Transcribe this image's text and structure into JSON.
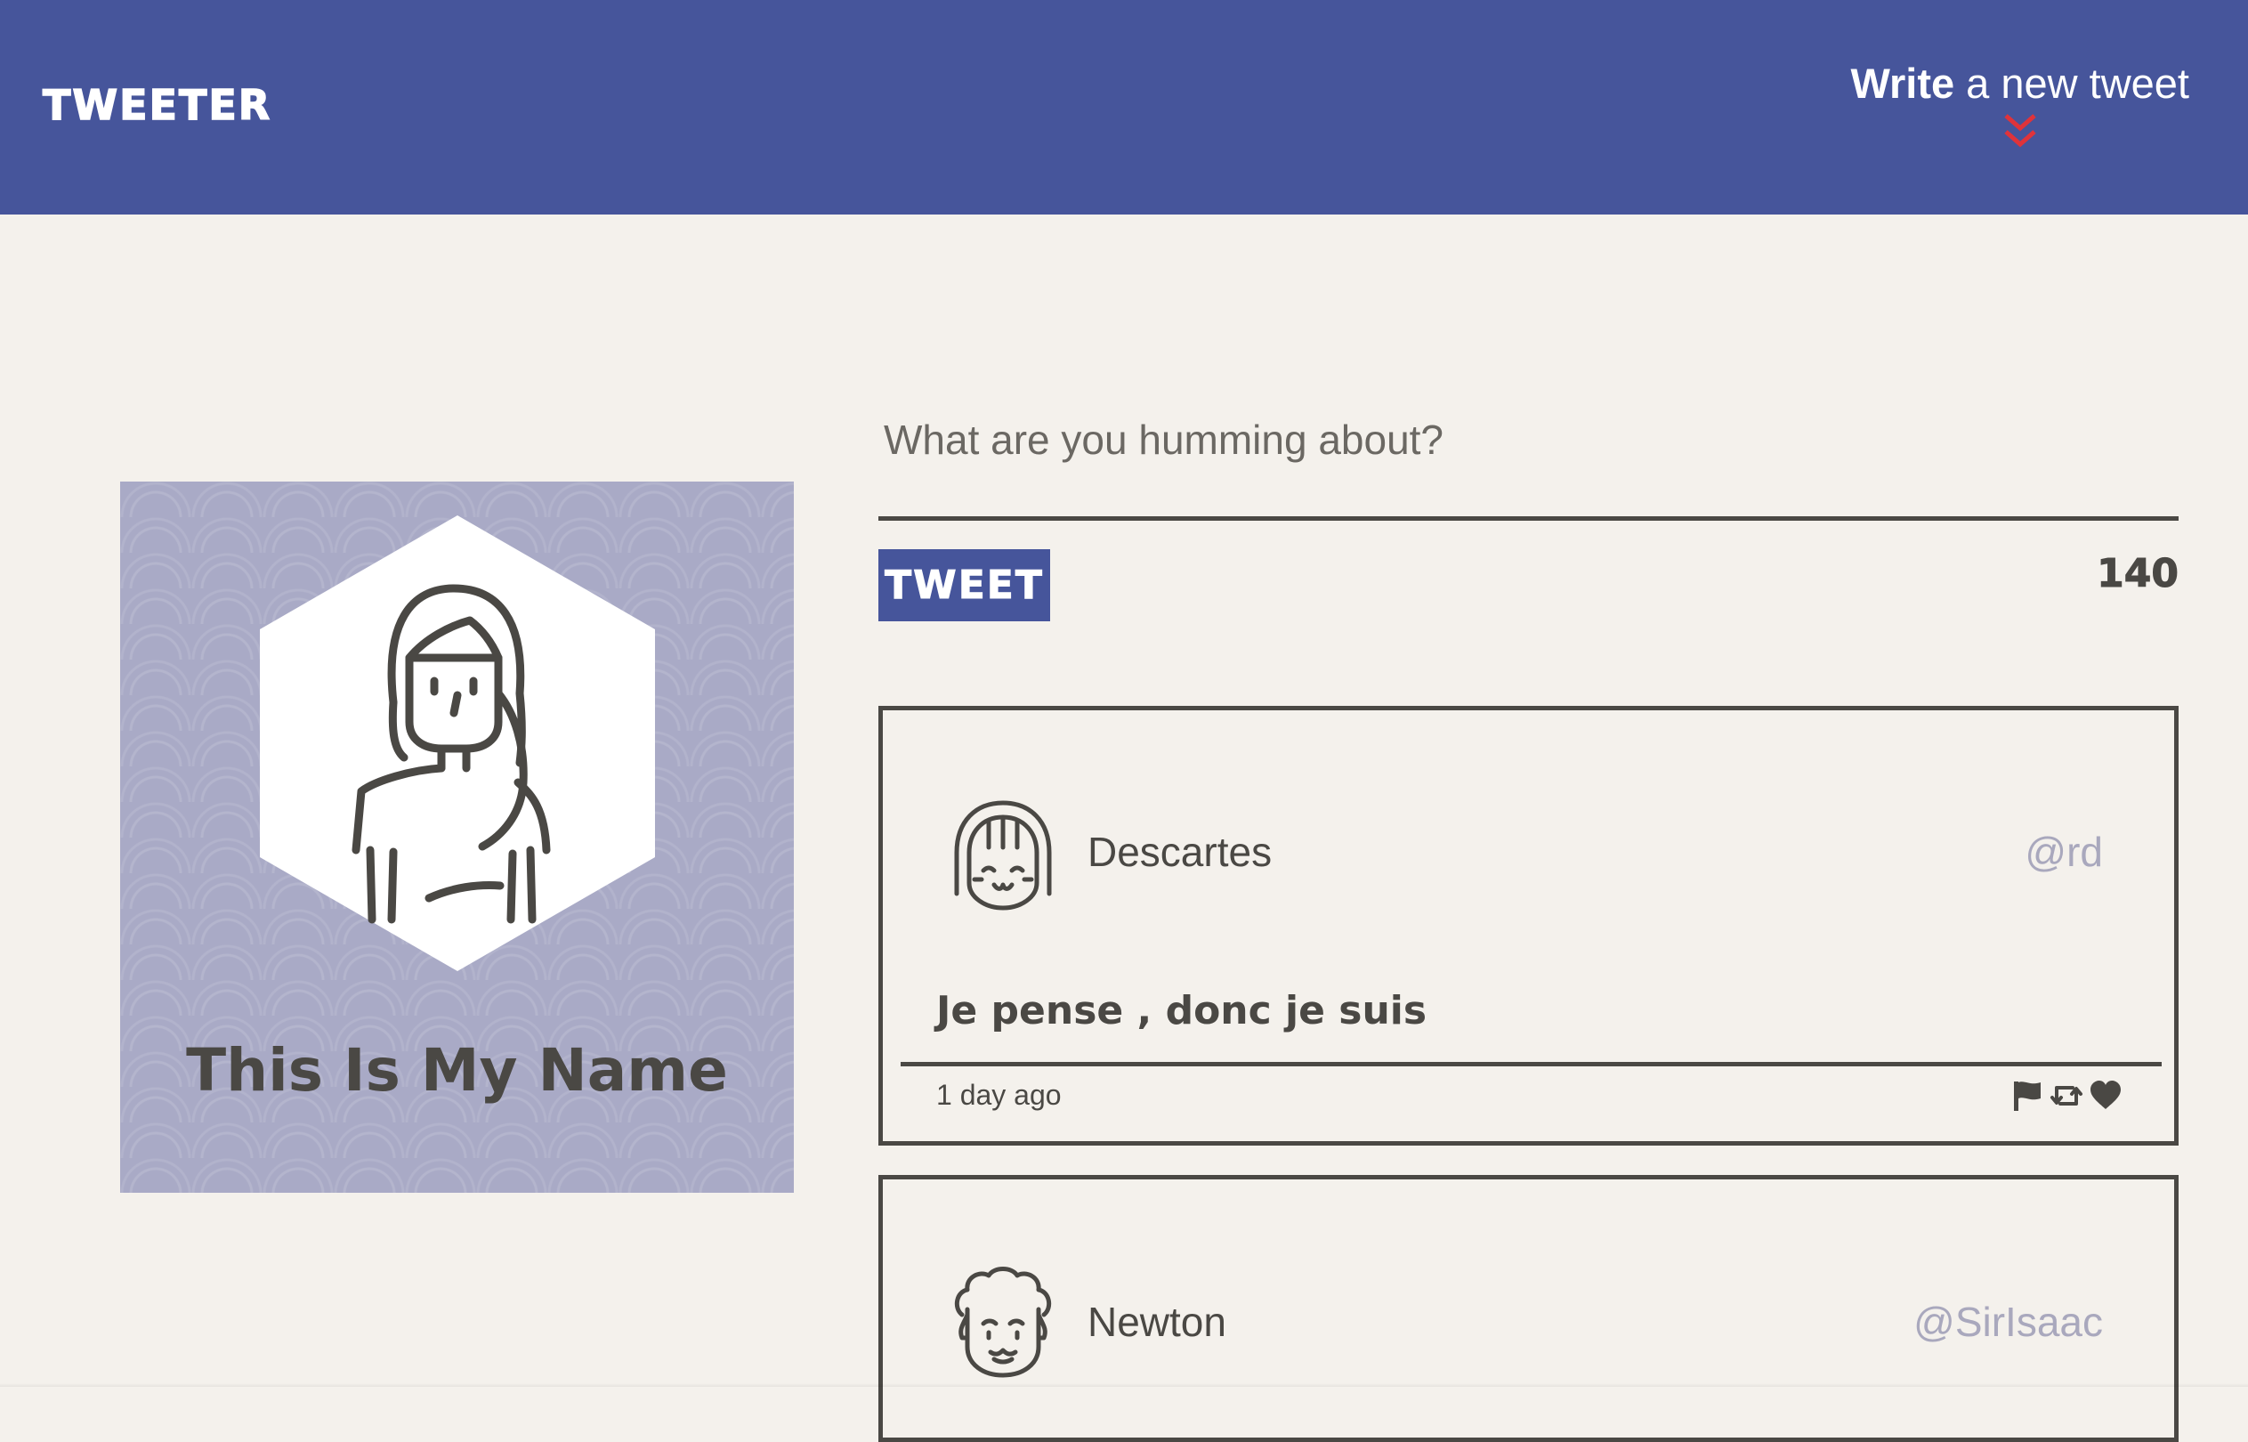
{
  "header": {
    "brand": "TWEETER",
    "compose_toggle_bold": "Write",
    "compose_toggle_rest": " a new tweet",
    "chevron_icon": "double-chevron-down-icon"
  },
  "profile": {
    "name": "This Is My Name",
    "avatar_icon": "woman-avatar-icon"
  },
  "compose": {
    "placeholder": "What are you humming about?",
    "value": "",
    "button_label": "TWEET",
    "counter": "140"
  },
  "tweets": [
    {
      "author": "Descartes",
      "handle": "@rd",
      "content": "Je pense , donc je suis",
      "time": "1 day ago",
      "avatar_icon": "girl-avatar-icon",
      "actions": [
        "flag-icon",
        "retweet-icon",
        "heart-icon"
      ]
    },
    {
      "author": "Newton",
      "handle": "@SirIsaac",
      "avatar_icon": "curly-hair-avatar-icon"
    }
  ],
  "colors": {
    "header_bg": "#46559b",
    "page_bg": "#f4f1ec",
    "text_dark": "#4a4844",
    "chevron": "#e0333a",
    "profile_bg": "#a9aac6",
    "handle": "#a9a8bd"
  }
}
